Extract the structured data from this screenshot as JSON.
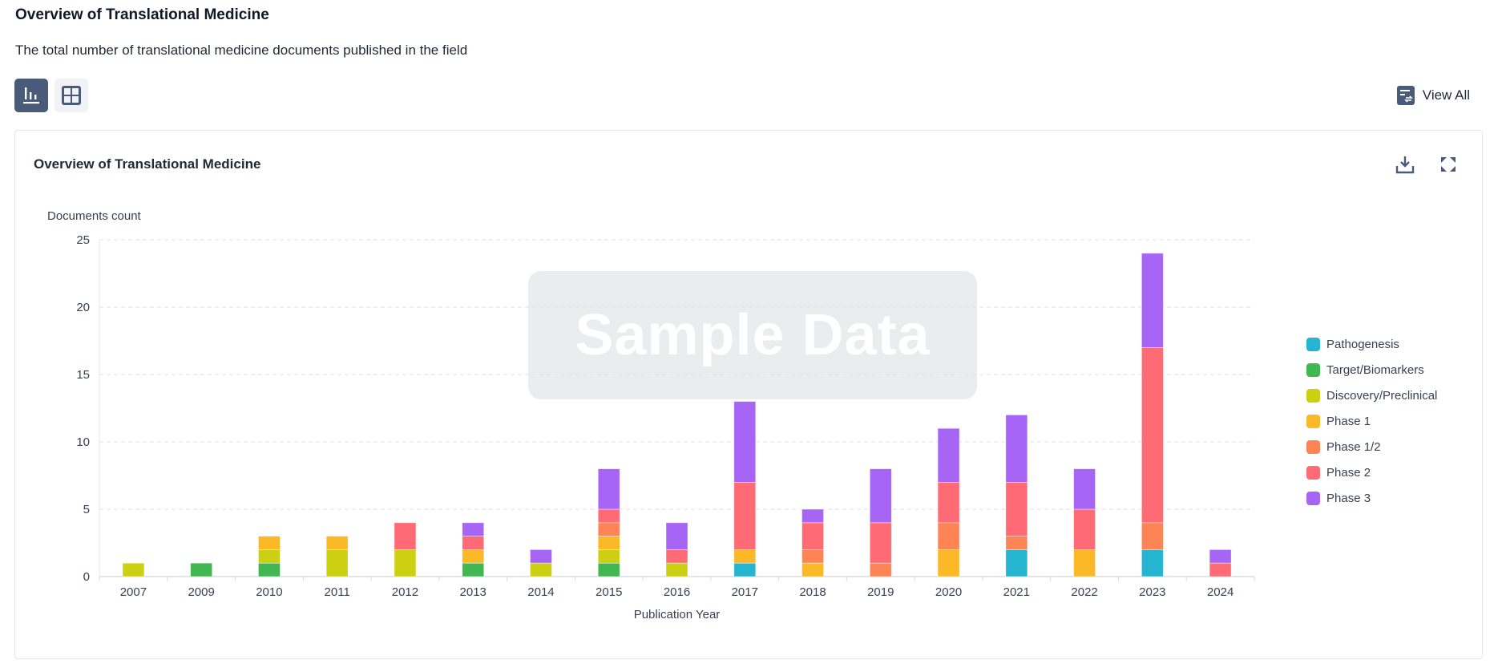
{
  "header": {
    "title": "Overview of Translational Medicine",
    "description": "The total number of translational medicine documents published in the field",
    "view_all_label": "View All",
    "view_toggle": [
      {
        "name": "chart-view",
        "icon": "bar-chart-icon",
        "active": true
      },
      {
        "name": "table-view",
        "icon": "grid-icon",
        "active": false
      }
    ]
  },
  "card": {
    "title": "Overview of Translational Medicine",
    "actions": [
      {
        "name": "download",
        "icon": "download-icon"
      },
      {
        "name": "fullscreen",
        "icon": "expand-icon"
      }
    ],
    "overlay_text": "Sample Data"
  },
  "chart_data": {
    "type": "bar",
    "stacked": true,
    "title": "Overview of Translational Medicine",
    "xlabel": "Publication Year",
    "ylabel": "Documents count",
    "ylim": [
      0,
      25
    ],
    "yticks": [
      0,
      5,
      10,
      15,
      20,
      25
    ],
    "grid": true,
    "legend_position": "right",
    "categories": [
      "2007",
      "2009",
      "2010",
      "2011",
      "2012",
      "2013",
      "2014",
      "2015",
      "2016",
      "2017",
      "2018",
      "2019",
      "2020",
      "2021",
      "2022",
      "2023",
      "2024"
    ],
    "series": [
      {
        "name": "Pathogenesis",
        "color": "#26b5d0",
        "values": [
          0,
          0,
          0,
          0,
          0,
          0,
          0,
          0,
          0,
          1,
          0,
          0,
          0,
          2,
          0,
          2,
          0
        ]
      },
      {
        "name": "Target/Biomarkers",
        "color": "#41b752",
        "values": [
          0,
          1,
          1,
          0,
          0,
          1,
          0,
          1,
          0,
          0,
          0,
          0,
          0,
          0,
          0,
          0,
          0
        ]
      },
      {
        "name": "Discovery/Preclinical",
        "color": "#cdd012",
        "values": [
          1,
          0,
          1,
          2,
          2,
          0,
          1,
          1,
          1,
          0,
          0,
          0,
          0,
          0,
          0,
          0,
          0
        ]
      },
      {
        "name": "Phase 1",
        "color": "#fbb827",
        "values": [
          0,
          0,
          1,
          1,
          0,
          1,
          0,
          1,
          0,
          1,
          1,
          0,
          2,
          0,
          2,
          0,
          0
        ]
      },
      {
        "name": "Phase 1/2",
        "color": "#fe8456",
        "values": [
          0,
          0,
          0,
          0,
          0,
          0,
          0,
          1,
          0,
          0,
          1,
          1,
          2,
          1,
          0,
          2,
          0
        ]
      },
      {
        "name": "Phase 2",
        "color": "#ff6b74",
        "values": [
          0,
          0,
          0,
          0,
          2,
          1,
          0,
          1,
          1,
          5,
          2,
          3,
          3,
          4,
          3,
          13,
          1
        ]
      },
      {
        "name": "Phase 3",
        "color": "#a765f5",
        "values": [
          0,
          0,
          0,
          0,
          0,
          1,
          1,
          3,
          2,
          6,
          1,
          4,
          4,
          5,
          3,
          7,
          1
        ]
      }
    ]
  }
}
